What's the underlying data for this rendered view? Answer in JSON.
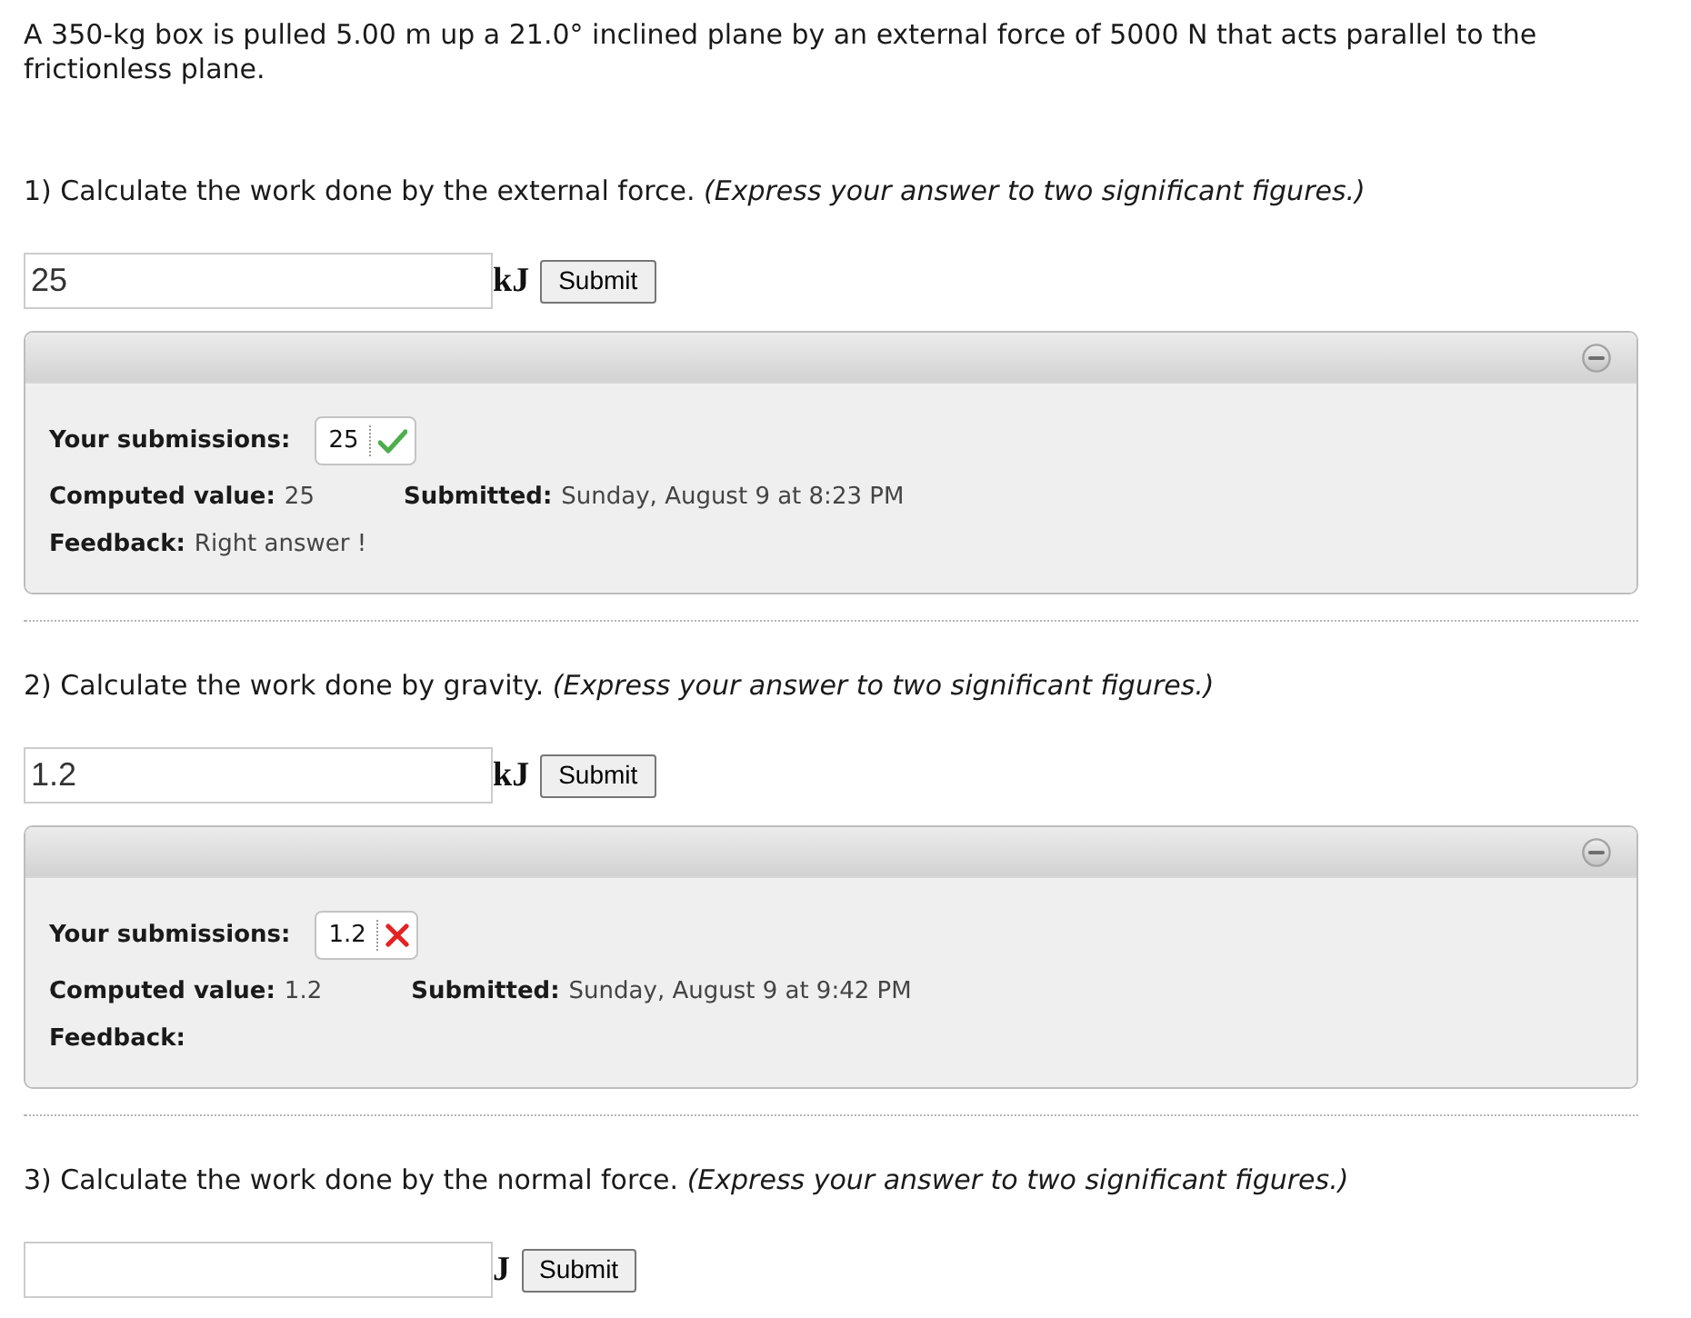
{
  "intro": "A 350-kg box is pulled 5.00 m up a 21.0° inclined plane by an external force of 5000 N that acts parallel to the frictionless plane.",
  "questions": [
    {
      "prompt": "1) Calculate the work done by the external force. *(Express your answer to two significant figures.)*",
      "answer": {
        "value": "25",
        "unit": "kJ"
      },
      "submit": "Submit",
      "panel": {
        "expanded": true,
        "submissions_label": "Your submissions:",
        "submissions": [
          {
            "value": "25",
            "correct": true
          }
        ],
        "computed": {
          "label": "Computed value:",
          "value": "25"
        },
        "submitted": {
          "label": "Submitted:",
          "value": "Sunday, August 9 at 8:23 PM"
        },
        "feedback": {
          "label": "Feedback:",
          "value": "Right answer !"
        }
      }
    },
    {
      "prompt": "2) Calculate the work done by gravity. *(Express your answer to two significant figures.)*",
      "answer": {
        "value": "1.2",
        "unit": "kJ"
      },
      "submit": "Submit",
      "panel": {
        "expanded": true,
        "submissions_label": "Your submissions:",
        "submissions": [
          {
            "value": "1.2",
            "correct": false
          }
        ],
        "computed": {
          "label": "Computed value:",
          "value": "1.2"
        },
        "submitted": {
          "label": "Submitted:",
          "value": "Sunday, August 9 at 9:42 PM"
        },
        "feedback": {
          "label": "Feedback:"
        }
      }
    },
    {
      "prompt": "3) Calculate the work done by the normal force. *(Express your answer to two significant figures.)*",
      "answer": {
        "unit": "J"
      },
      "submit": "Submit"
    }
  ]
}
